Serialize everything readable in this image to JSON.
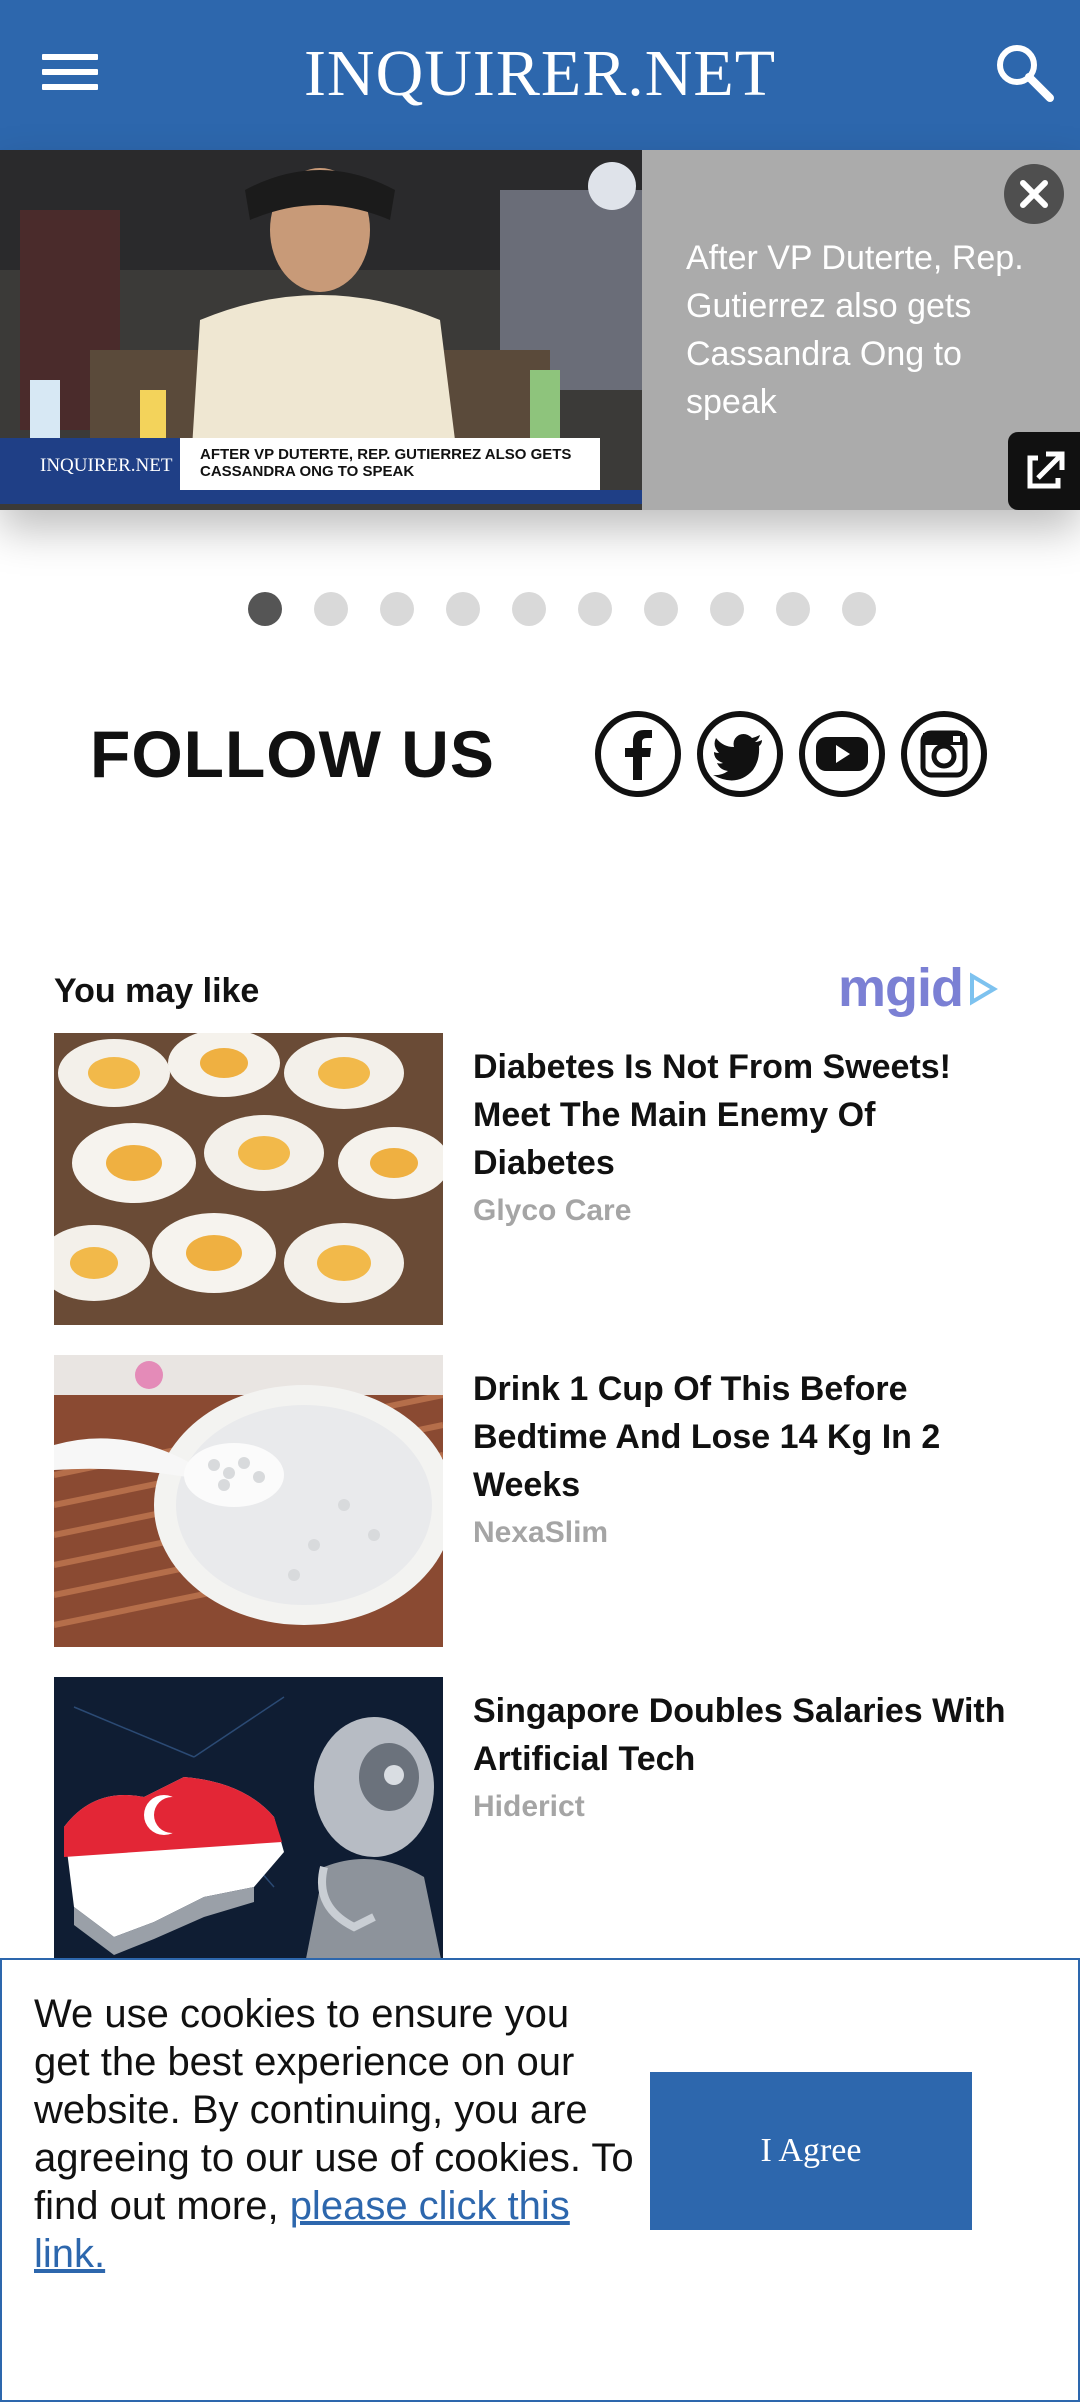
{
  "header": {
    "logo": "INQUIRER.NET",
    "menu_icon": "hamburger-menu-icon",
    "search_icon": "search-icon",
    "background": "#2d67ad"
  },
  "video": {
    "caption": "After VP Duterte, Rep. Gutierrez also gets Cassandra Ong to speak",
    "lower_third_brand": "INQUIRER.NET",
    "lower_third_text": "AFTER VP DUTERTE, REP. GUTIERREZ ALSO GETS CASSANDRA ONG TO SPEAK",
    "close_icon": "close-icon",
    "share_icon": "share-external-icon"
  },
  "carousel": {
    "total": 10,
    "active_index": 0
  },
  "follow": {
    "title": "FOLLOW US",
    "networks": [
      "facebook-icon",
      "twitter-icon",
      "youtube-icon",
      "instagram-icon"
    ]
  },
  "recommendations": {
    "title": "You may like",
    "provider": "mgid",
    "items": [
      {
        "headline": "Diabetes Is Not From Sweets! Meet The Main Enemy Of Diabetes",
        "source": "Glyco Care"
      },
      {
        "headline": "Drink 1 Cup Of This Before Bedtime And Lose 14 Kg In 2 Weeks",
        "source": "NexaSlim"
      },
      {
        "headline": "Singapore Doubles Salaries With Artificial Tech",
        "source": "Hiderict"
      }
    ]
  },
  "cookie": {
    "text": "We use cookies to ensure you get the best experience on our website. By continuing, you are agreeing to our use of cookies. To find out more, ",
    "link_text": "please click this link.",
    "button": "I Agree",
    "accent": "#2d67ad"
  }
}
